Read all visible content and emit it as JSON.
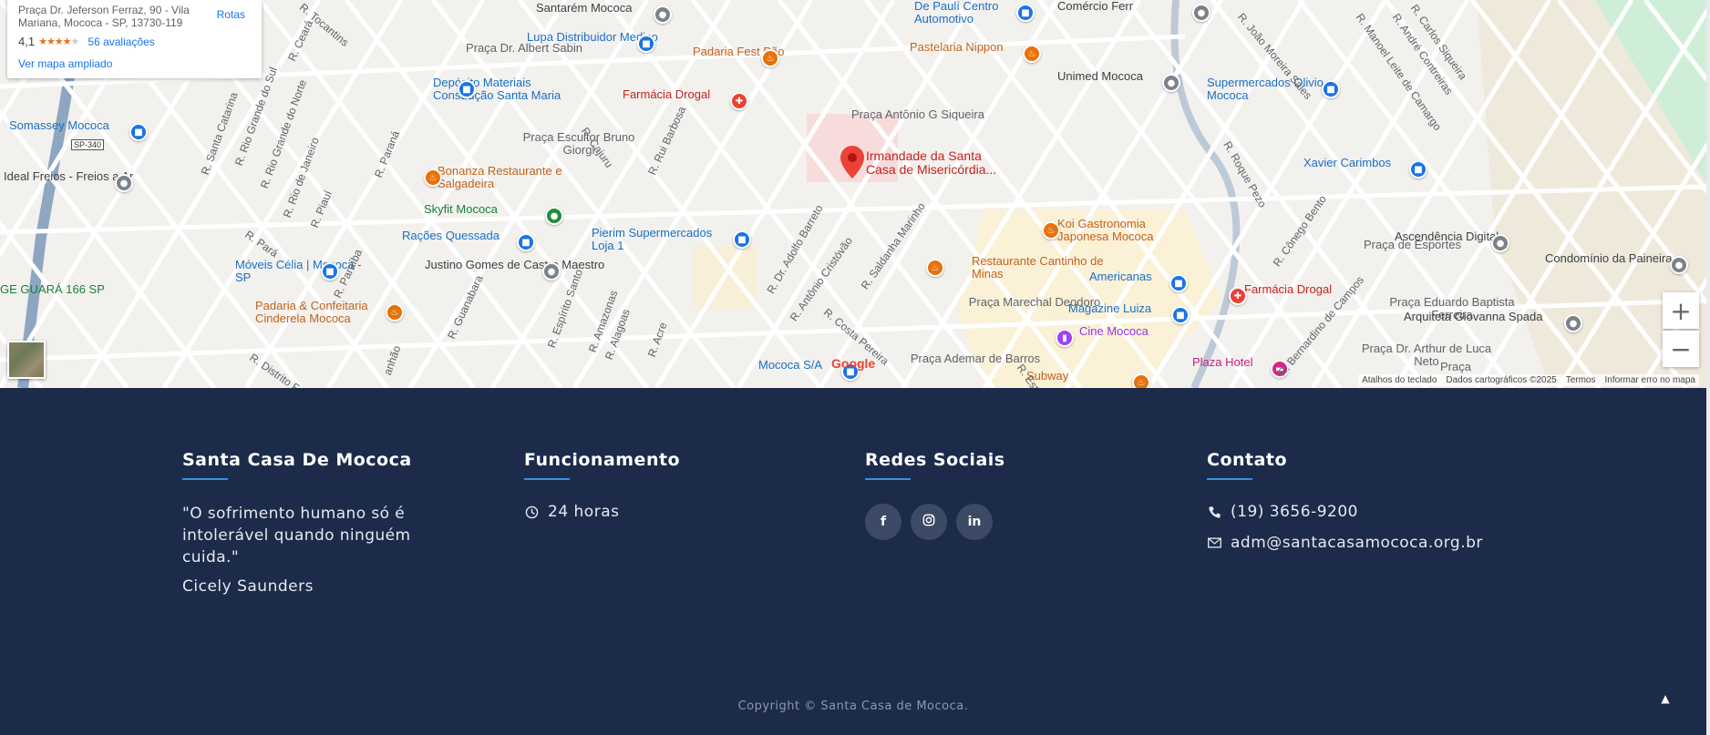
{
  "map": {
    "info_card": {
      "address": "Praça Dr. Jeferson Ferraz, 90 - Vila Mariana, Mococa - SP, 13730-119",
      "directions_label": "Rotas",
      "rating": "4,1",
      "rating_value": 4.1,
      "reviews": "56 avaliações",
      "bigger_map": "Ver mapa ampliado"
    },
    "selected_place": "Irmandade da Santa Casa de Misericórdia...",
    "google_logo": "Google",
    "footer_links": [
      "Atalhos do teclado",
      "Dados cartográficos ©2025",
      "Termos",
      "Informar erro no mapa"
    ],
    "zoom_in": "+",
    "zoom_out": "−",
    "route_shield": "SP-340",
    "places": [
      {
        "text": "Santarém Mococa",
        "style": "dark"
      },
      {
        "text": "De Paulí Centro Automotivo",
        "style": "blue"
      },
      {
        "text": "Comércio Ferr",
        "style": "dark"
      },
      {
        "text": "Lupa Distribuidor Medico",
        "style": "blue"
      },
      {
        "text": "Praça Dr. Albert Sabin",
        "style": "place"
      },
      {
        "text": "Padaria Fest Pão",
        "style": "orange"
      },
      {
        "text": "Pastelaria Nippon",
        "style": "orange"
      },
      {
        "text": "Unimed Mococa",
        "style": "dark"
      },
      {
        "text": "Supermercados Olivio - Mococa",
        "style": "blue"
      },
      {
        "text": "Depósito Materiais Construção Santa Maria",
        "style": "blue"
      },
      {
        "text": "Farmácia Drogal",
        "style": "red"
      },
      {
        "text": "Praça Antônio G Siqueira",
        "style": "place"
      },
      {
        "text": "Somassey Mococa",
        "style": "blue"
      },
      {
        "text": "Praça Escultor Bruno Giorgi",
        "style": "place"
      },
      {
        "text": "Xavier Carimbos",
        "style": "blue"
      },
      {
        "text": "Ideal Freios - Freios a Ar",
        "style": "dark"
      },
      {
        "text": "Bonanza Restaurante e Salgadeira",
        "style": "orange"
      },
      {
        "text": "Skyfit Mococa",
        "style": "green"
      },
      {
        "text": "Koi Gastronomia Japonesa Mococa",
        "style": "orange"
      },
      {
        "text": "Rações Quessada",
        "style": "blue"
      },
      {
        "text": "Pierim Supermercados Loja 1",
        "style": "blue"
      },
      {
        "text": "Ascendência Digital",
        "style": "dark"
      },
      {
        "text": "Praça de Esportes",
        "style": "place"
      },
      {
        "text": "Condomínio da Paineira",
        "style": "dark"
      },
      {
        "text": "Móveis Célia | Mococa - SP",
        "style": "blue"
      },
      {
        "text": "Justino Gomes de Castro Maestro",
        "style": "dark"
      },
      {
        "text": "Restaurante Cantinho de Minas",
        "style": "orange"
      },
      {
        "text": "Americanas",
        "style": "blue"
      },
      {
        "text": "GE GUARÁ 166 SP",
        "style": "green"
      },
      {
        "text": "Farmácia Drogal",
        "style": "red"
      },
      {
        "text": "Praça Marechal Deodoro",
        "style": "place"
      },
      {
        "text": "Magazine Luiza",
        "style": "blue"
      },
      {
        "text": "Praça Eduardo Baptista Ferreira",
        "style": "place"
      },
      {
        "text": "Arquiteta Giovanna Spada",
        "style": "dark"
      },
      {
        "text": "Padaria & Confeitaria Cinderela Mococa",
        "style": "orange"
      },
      {
        "text": "Cine Mococa",
        "style": "purple"
      },
      {
        "text": "Praça Dr. Arthur de Luca Neto",
        "style": "place"
      },
      {
        "text": "Mococa S/A",
        "style": "blue"
      },
      {
        "text": "Praça Ademar de Barros",
        "style": "place"
      },
      {
        "text": "Plaza Hotel",
        "style": "pink"
      },
      {
        "text": "Subway",
        "style": "orange"
      },
      {
        "text": "Praça",
        "style": "place"
      }
    ],
    "streets": [
      "R. Tocantins",
      "R. Ceará",
      "R. Santa Catarina",
      "R. Rio Grande do Sul",
      "R. Rio Grande do Norte",
      "R. Rio de Janeiro",
      "R. Paraná",
      "R. Piauí",
      "R. Pará",
      "R. Paraíba",
      "R. Distrito Fe",
      "R. Guanabara",
      "R. Espírito Santo",
      "R. Amazonas",
      "R. Alagoas",
      "R. Acre",
      "R. Cajuru",
      "R. Rui Barbosa",
      "R. Dr. Adolfo Barreto",
      "R. Antônio Cristóvão",
      "R. Saldanha Marinho",
      "R. Costa Pereira",
      "R. Roque Pezo",
      "R. Cônego Bento",
      "R. João Moreira Sales",
      "R. Manoel Leite de Camargo",
      "R. Carlos Siqueira",
      "R. André Contreiras",
      "R. Bernardino de Campos",
      "R. Estê",
      "anhão"
    ]
  },
  "footer": {
    "about": {
      "heading": "Santa Casa De Mococa",
      "quote": "\"O sofrimento humano só é intolerável quando ninguém cuida.\"",
      "author": "Cicely Saunders"
    },
    "hours": {
      "heading": "Funcionamento",
      "value": "24 horas"
    },
    "social": {
      "heading": "Redes Sociais",
      "items": [
        {
          "icon": "facebook-icon",
          "glyph": "f"
        },
        {
          "icon": "instagram-icon",
          "glyph": "◎"
        },
        {
          "icon": "linkedin-icon",
          "glyph": "in"
        }
      ]
    },
    "contact": {
      "heading": "Contato",
      "phone": "(19) 3656-9200",
      "email": "adm@santacasamococa.org.br"
    },
    "copyright": "Copyright ©  Santa Casa de Mococa.",
    "back_to_top": "▲"
  },
  "colors": {
    "footer_bg": "#1c2b4a",
    "accent": "#3a8fe0",
    "map_bg": "#f3f1ee"
  }
}
